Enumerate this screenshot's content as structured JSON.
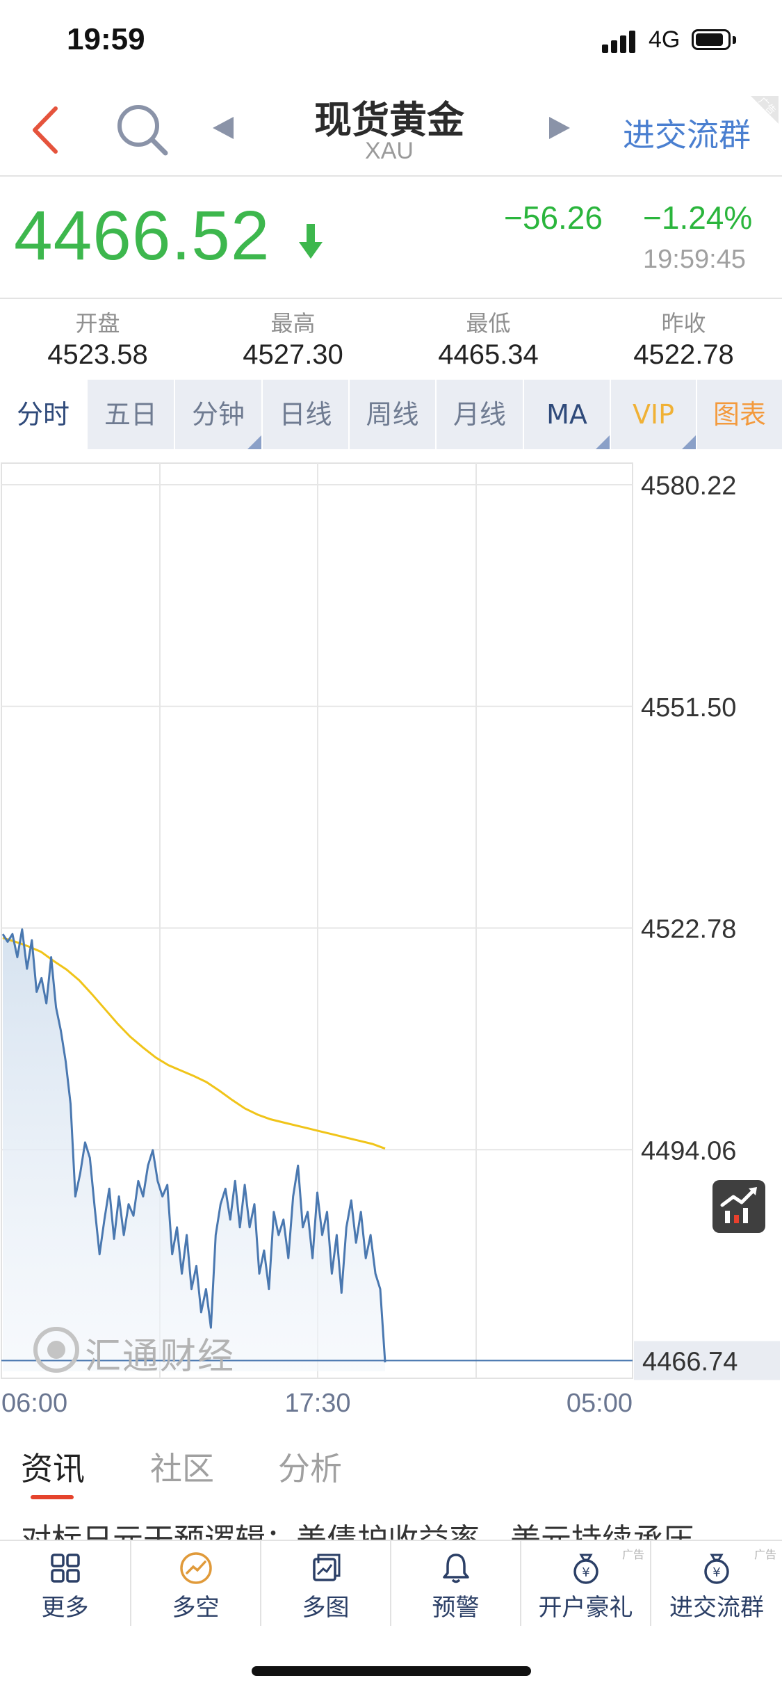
{
  "status_bar": {
    "time": "19:59",
    "network": "4G"
  },
  "nav": {
    "title": "现货黄金",
    "subtitle": "XAU",
    "join_group_label": "进交流群",
    "ad_tag": "广告"
  },
  "quote": {
    "price": "4466.52",
    "change": "−56.26",
    "change_pct": "−1.24%",
    "update_time": "19:59:45",
    "trend": "down",
    "color_down": "#3db74d"
  },
  "stats": [
    {
      "label": "开盘",
      "value": "4523.58"
    },
    {
      "label": "最高",
      "value": "4527.30"
    },
    {
      "label": "最低",
      "value": "4465.34"
    },
    {
      "label": "昨收",
      "value": "4522.78"
    }
  ],
  "tabs": [
    {
      "label": "分时",
      "active": true
    },
    {
      "label": "五日"
    },
    {
      "label": "分钟",
      "has_dropdown": true
    },
    {
      "label": "日线"
    },
    {
      "label": "周线"
    },
    {
      "label": "月线"
    },
    {
      "label": "MA",
      "has_dropdown": true
    },
    {
      "label": "VIP",
      "has_dropdown": true
    },
    {
      "label": "图表"
    }
  ],
  "chart_data": {
    "type": "line",
    "y_ticks": [
      "4580.22",
      "4551.50",
      "4522.78",
      "4494.06"
    ],
    "x_ticks": [
      "06:00",
      "17:30",
      "05:00"
    ],
    "ylim": [
      4465.34,
      4580.22
    ],
    "current_price_label": "4466.74",
    "series": [
      {
        "style": "price-line",
        "color": "#4a78b0",
        "values": [
          4522.0,
          4521.0,
          4522.0,
          4519.0,
          4522.6,
          4517.5,
          4521.2,
          4514.5,
          4516.3,
          4513.0,
          4519.0,
          4512.5,
          4509.5,
          4505.5,
          4500.0,
          4488.0,
          4491.0,
          4495.0,
          4493.0,
          4486.5,
          4480.5,
          4485.0,
          4489.0,
          4482.5,
          4488.0,
          4483.0,
          4487.0,
          4485.5,
          4490.0,
          4488.0,
          4492.0,
          4494.0,
          4490.0,
          4488.0,
          4489.5,
          4480.5,
          4484.0,
          4478.0,
          4483.0,
          4476.0,
          4479.0,
          4473.0,
          4476.0,
          4471.0,
          4483.0,
          4487.0,
          4489.0,
          4485.0,
          4490.0,
          4484.0,
          4489.5,
          4484.0,
          4487.0,
          4478.0,
          4481.0,
          4476.0,
          4486.0,
          4483.0,
          4485.0,
          4480.0,
          4488.0,
          4492.0,
          4484.0,
          4486.0,
          4480.0,
          4488.5,
          4483.0,
          4486.0,
          4478.0,
          4483.0,
          4475.5,
          4484.0,
          4487.5,
          4482.0,
          4486.0,
          4480.0,
          4483.0,
          4478.0,
          4476.0,
          4466.5
        ]
      },
      {
        "style": "average-line",
        "color": "#f0c419",
        "values": [
          4521.5,
          4521.0,
          4520.4,
          4519.7,
          4518.5,
          4517.4,
          4516.0,
          4514.2,
          4512.3,
          4510.4,
          4508.7,
          4507.3,
          4506.0,
          4505.0,
          4504.3,
          4503.6,
          4502.8,
          4501.7,
          4500.5,
          4499.4,
          4498.6,
          4498.0,
          4497.6,
          4497.2,
          4496.8,
          4496.4,
          4496.0,
          4495.6,
          4495.2,
          4494.8,
          4494.2
        ]
      }
    ]
  },
  "watermark": "汇通财经",
  "news_tabs": [
    "资讯",
    "社区",
    "分析"
  ],
  "headline": "对标日元干预逻辑：美债护收益率，美元持续承压",
  "bottom_bar": [
    {
      "label": "更多",
      "icon": "grid-icon"
    },
    {
      "label": "多空",
      "icon": "trend-circle-icon"
    },
    {
      "label": "多图",
      "icon": "multi-chart-icon"
    },
    {
      "label": "预警",
      "icon": "bell-icon"
    },
    {
      "label": "开户豪礼",
      "icon": "money-bag-icon",
      "ad": "广告"
    },
    {
      "label": "进交流群",
      "icon": "money-bag-icon",
      "ad": "广告"
    }
  ]
}
